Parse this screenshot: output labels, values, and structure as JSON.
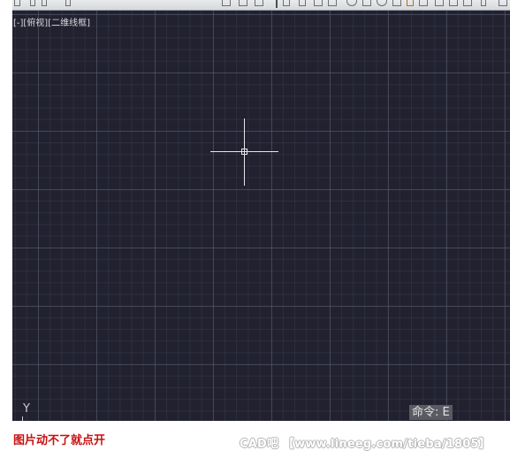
{
  "viewport": {
    "view_label": "[-][俯视][二维线框]",
    "ucs_axis_label": "Y",
    "command_prompt": "命令: E",
    "background_color": "#212130"
  },
  "toolbar": {
    "icons": [
      "toolbar-icon",
      "toolbar-icon",
      "toolbar-icon",
      "toolbar-icon",
      "toolbar-icon",
      "toolbar-icon"
    ]
  },
  "footer": {
    "caption": "图片动不了就点开",
    "caption_color": "#c81010",
    "watermark": "CAD吧 【www.lineeg.com/tieba/1805】"
  }
}
